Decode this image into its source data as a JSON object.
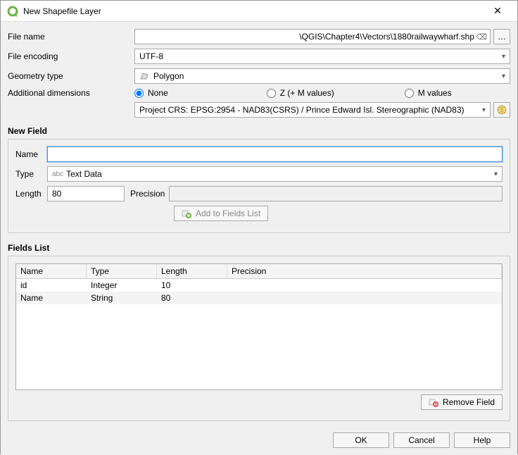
{
  "window": {
    "title": "New Shapefile Layer"
  },
  "form": {
    "fileNameLabel": "File name",
    "fileName": "\\QGIS\\Chapter4\\Vectors\\1880railwaywharf.shp",
    "browse": "…",
    "fileEncodingLabel": "File encoding",
    "fileEncoding": "UTF-8",
    "geometryTypeLabel": "Geometry type",
    "geometryType": "Polygon",
    "dimensionsLabel": "Additional dimensions",
    "dimNone": "None",
    "dimZ": "Z (+ M values)",
    "dimM": "M values",
    "crs": "Project CRS: EPSG:2954 - NAD83(CSRS) / Prince Edward Isl. Stereographic (NAD83)"
  },
  "newField": {
    "section": "New Field",
    "nameLabel": "Name",
    "nameValue": "",
    "typeLabel": "Type",
    "typeValue": "Text Data",
    "typePrefix": "abc",
    "lengthLabel": "Length",
    "lengthValue": "80",
    "precisionLabel": "Precision",
    "precisionValue": "",
    "addBtn": "Add to Fields List"
  },
  "fieldsList": {
    "section": "Fields List",
    "headers": {
      "name": "Name",
      "type": "Type",
      "length": "Length",
      "precision": "Precision"
    },
    "rows": [
      {
        "name": "id",
        "type": "Integer",
        "length": "10",
        "precision": ""
      },
      {
        "name": "Name",
        "type": "String",
        "length": "80",
        "precision": ""
      }
    ],
    "removeBtn": "Remove Field"
  },
  "footer": {
    "ok": "OK",
    "cancel": "Cancel",
    "help": "Help"
  }
}
